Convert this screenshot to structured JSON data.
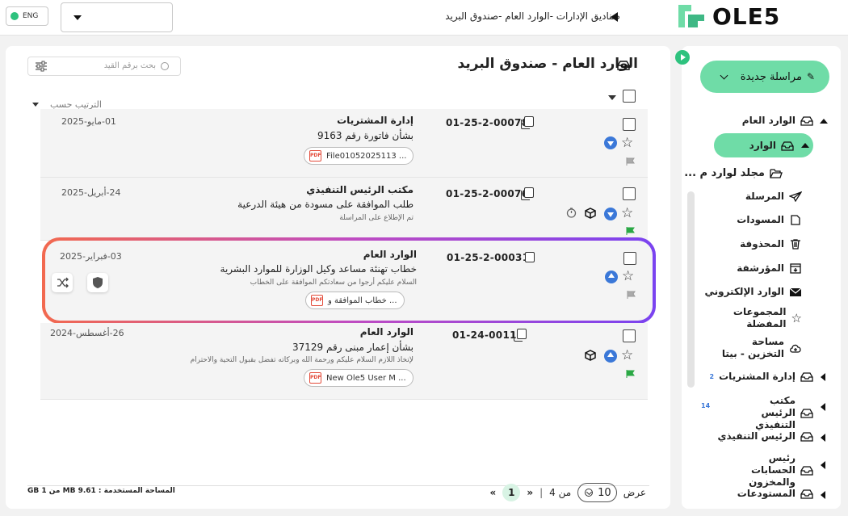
{
  "topbar": {
    "language": "ENG",
    "breadcrumb": "صناديق الإدارات  -الوارد العام -صندوق البريد",
    "logo_text": "OLE5"
  },
  "main": {
    "title": "الوارد العام - صندوق البريد",
    "search_placeholder": "بحث برقم القيد",
    "sort_label": "الترتيب حسب",
    "rows": [
      {
        "number": "01-25-2-00078",
        "dept": "إدارة المشتريات",
        "subject": "بشأن فاتورة رقم 9163",
        "snippet": "",
        "attachment": "File01052025113 ...",
        "date": "01-مايو-2025"
      },
      {
        "number": "01-25-2-00076",
        "dept": "مكتب الرئيس التنفيذي",
        "subject": "طلب الموافقة على مسودة من هيئة الدرعية",
        "snippet": "تم الإطلاع على المراسلة",
        "attachment": "",
        "date": "24-أبريل-2025"
      },
      {
        "number": "01-25-2-00031",
        "dept": "الوارد العام",
        "subject": "خطاب تهنئة مساعد وكيل الوزارة للموارد البشرية",
        "snippet": "السلام عليكم أرجوا من سعادتكم الموافقة على الخطاب",
        "attachment": "خطاب الموافقة و ...",
        "date": "03-فبراير-2025"
      },
      {
        "number": "01-24-00113",
        "dept": "الوارد العام",
        "subject": "بشأن إعمار مبنى رقم 37129",
        "snippet": "لإتخاذ اللازم السلام عليكم ورحمة الله وبركاته تفضل بقبول التحية والاحترام",
        "attachment": "New Ole5 User M ...",
        "date": "26-أغسطس-2024"
      }
    ],
    "storage": "المساحة المستخدمة : 9.61 MB من 1 GB",
    "pager": {
      "show_label": "عرض",
      "per_page": "10",
      "of_label": "من 4",
      "current_page": "1",
      "prev": "«",
      "next": "»"
    }
  },
  "sidebar": {
    "new_button": "مراسلة جديدة",
    "items": [
      {
        "label": "الوارد العام"
      },
      {
        "label": "الوارد"
      },
      {
        "label": "مجلد لوارد م ..."
      },
      {
        "label": "المرسلة"
      },
      {
        "label": "المسودات"
      },
      {
        "label": "المحذوفة"
      },
      {
        "label": "المؤرشفة"
      },
      {
        "label": "الوارد الإلكتروني"
      },
      {
        "label": "المجموعات المفضلة"
      },
      {
        "label": "مساحة التخزين - بيتا"
      },
      {
        "label": "إدارة المشتريات",
        "badge": "2"
      },
      {
        "label": "مكتب الرئيس التنفيذي",
        "badge": "14"
      },
      {
        "label": "الرئيس التنفيذي"
      },
      {
        "label": "رئيس الحسابات والمخزون"
      },
      {
        "label": "المستودعات"
      }
    ]
  },
  "colors": {
    "accent": "#6fdca7",
    "blue": "#3b78d8",
    "highlight_start": "#f2694f",
    "highlight_end": "#7a43f0"
  }
}
